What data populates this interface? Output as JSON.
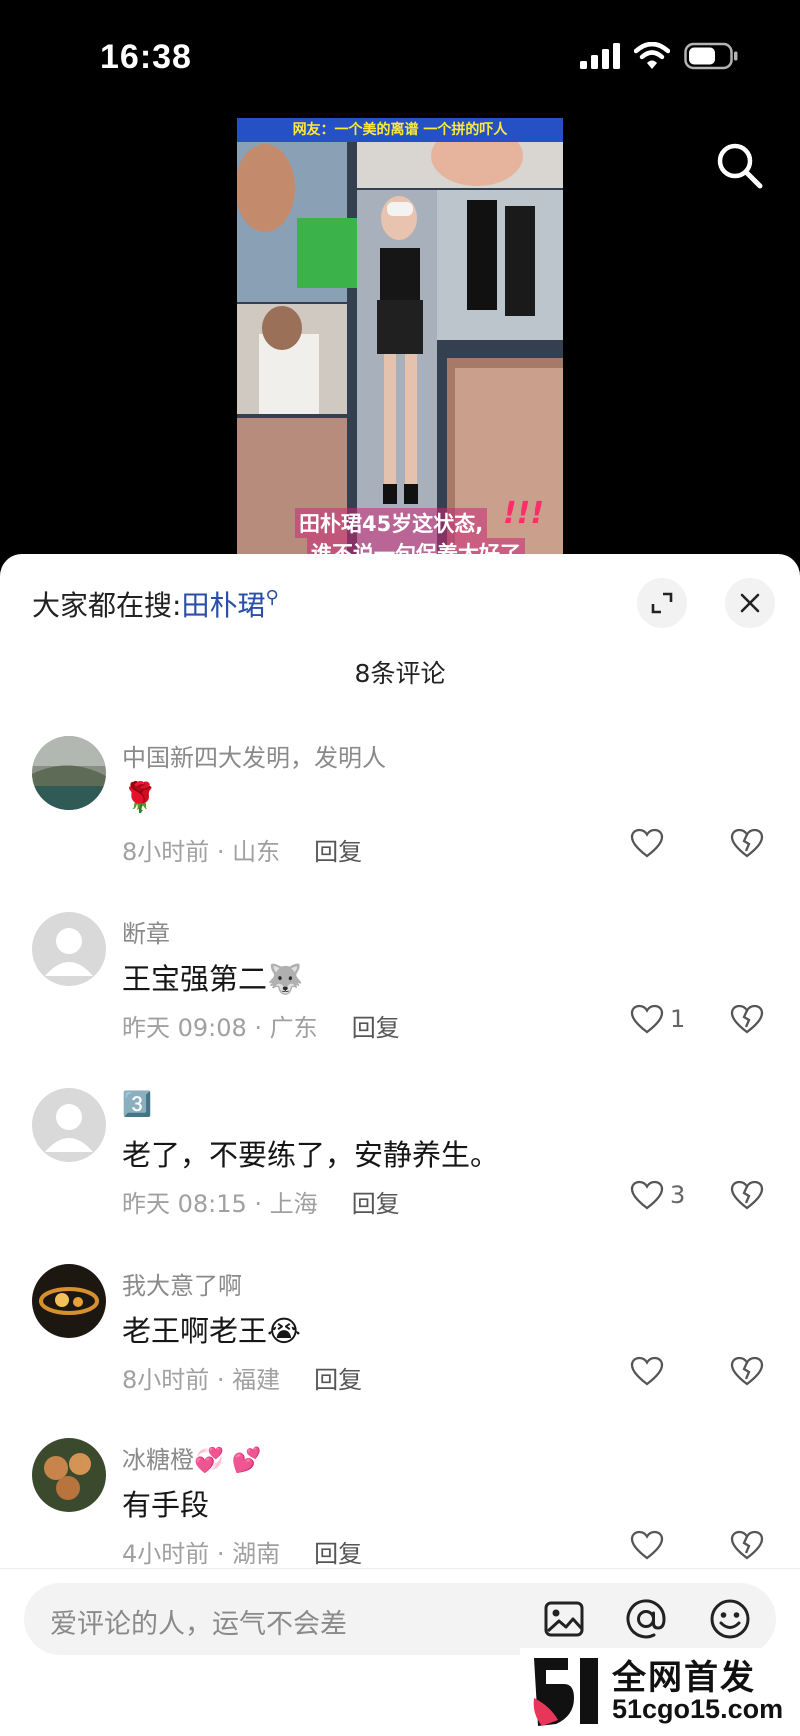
{
  "status_bar": {
    "time": "16:38"
  },
  "video": {
    "top_caption": "网友：一个美的离谱 一个拼的吓人",
    "caption_line1": "田朴珺45岁这状态,",
    "caption_line2": "谁不说一句保养太好了",
    "exclaim": "!!!"
  },
  "sheet": {
    "hot_search_label": "大家都在搜:",
    "hot_search_keyword": "田朴珺",
    "comment_count": "8条评论"
  },
  "comments": [
    {
      "user": "中国新四大发明，发明人",
      "text": "🌹",
      "time_loc": "8小时前 · 山东",
      "reply": "回复",
      "likes": ""
    },
    {
      "user": "断章",
      "text": "王宝强第二🐺",
      "time_loc": "昨天 09:08 · 广东",
      "reply": "回复",
      "likes": "1"
    },
    {
      "user": "3️⃣",
      "text": "老了，不要练了，安静养生。",
      "time_loc": "昨天 08:15 · 上海",
      "reply": "回复",
      "likes": "3"
    },
    {
      "user": "我大意了啊",
      "text": "老王啊老王😭",
      "time_loc": "8小时前 · 福建",
      "reply": "回复",
      "likes": ""
    },
    {
      "user": "冰糖橙💞 💕",
      "text": "有手段",
      "time_loc": "4小时前 · 湖南",
      "reply": "回复",
      "likes": ""
    }
  ],
  "input": {
    "placeholder": "爱评论的人，运气不会差"
  },
  "watermark": {
    "top": "全网首发",
    "bottom": "51cgo15.com"
  },
  "colors": {
    "keyword": "#2b4fa8",
    "sheet_bg": "#ffffff",
    "page_bg": "#000000"
  }
}
